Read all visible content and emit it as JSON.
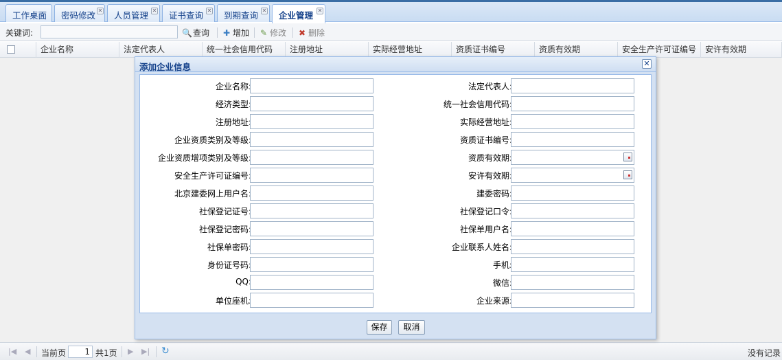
{
  "tabs": [
    {
      "label": "工作桌面",
      "closable": false
    },
    {
      "label": "密码修改",
      "closable": true
    },
    {
      "label": "人员管理",
      "closable": true
    },
    {
      "label": "证书查询",
      "closable": true
    },
    {
      "label": "到期查询",
      "closable": true
    },
    {
      "label": "企业管理",
      "closable": true,
      "active": true
    }
  ],
  "toolbar": {
    "keyword_label": "关键词:",
    "keyword_value": "",
    "search_label": "查询",
    "add_label": "增加",
    "edit_label": "修改",
    "delete_label": "删除"
  },
  "grid": {
    "columns": [
      "企业名称",
      "法定代表人",
      "统一社会信用代码",
      "注册地址",
      "实际经营地址",
      "资质证书编号",
      "资质有效期",
      "安全生产许可证编号",
      "安许有效期"
    ]
  },
  "pager": {
    "current_page_label": "当前页",
    "current_page": "1",
    "total_label": "共1页",
    "status": "没有记录"
  },
  "dialog": {
    "title": "添加企业信息",
    "close_glyph": "✕",
    "left_fields": [
      "企业名称:",
      "经济类型:",
      "注册地址:",
      "企业资质类别及等级:",
      "企业资质增项类别及等级:",
      "安全生产许可证编号:",
      "北京建委网上用户名:",
      "社保登记证号:",
      "社保登记密码:",
      "社保单密码:",
      "身份证号码:",
      "QQ:",
      "单位座机:"
    ],
    "right_fields": [
      "法定代表人:",
      "统一社会信用代码:",
      "实际经营地址:",
      "资质证书编号:",
      "资质有效期:",
      "安许有效期:",
      "建委密码:",
      "社保登记口令:",
      "社保单用户名:",
      "企业联系人姓名:",
      "手机:",
      "微信:",
      "企业来源:"
    ],
    "date_fields": [
      "资质有效期:",
      "安许有效期:"
    ],
    "save_label": "保存",
    "cancel_label": "取消"
  },
  "icons": {
    "search": "search-icon",
    "add": "plus-icon",
    "edit": "pencil-icon",
    "delete": "delete-icon",
    "calendar": "calendar-icon",
    "refresh": "refresh-icon"
  },
  "colors": {
    "accent": "#15428b",
    "border": "#99bbe8",
    "dialog_bg": "#d4e1f2"
  }
}
